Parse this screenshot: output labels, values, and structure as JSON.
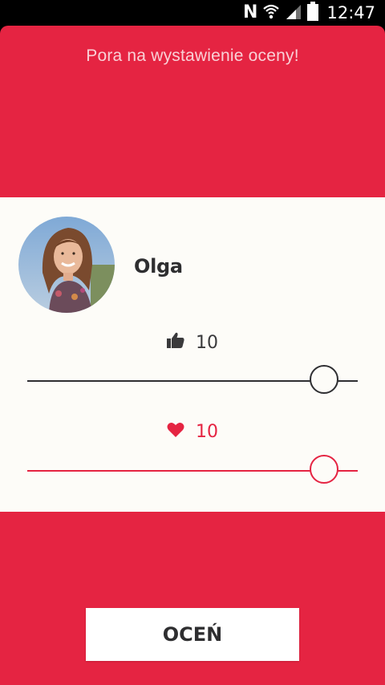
{
  "status_bar": {
    "time": "12:47",
    "icons": [
      "nfc-icon",
      "wifi-icon",
      "signal-icon",
      "battery-icon"
    ]
  },
  "header": {
    "title": "Pora na wystawienie oceny!"
  },
  "profile": {
    "name": "Olga",
    "avatar_icon": "avatar-photo"
  },
  "ratings": {
    "like": {
      "icon": "thumbs-up-icon",
      "value": "10",
      "level": 1.0,
      "color": "#2f2f32"
    },
    "heart": {
      "icon": "heart-icon",
      "value": "10",
      "level": 1.0,
      "color": "#e52442"
    }
  },
  "actions": {
    "submit_label": "OCEŃ"
  },
  "colors": {
    "accent": "#e52442",
    "card_background": "#fdfcf8",
    "header_text": "#f9d0d6"
  }
}
